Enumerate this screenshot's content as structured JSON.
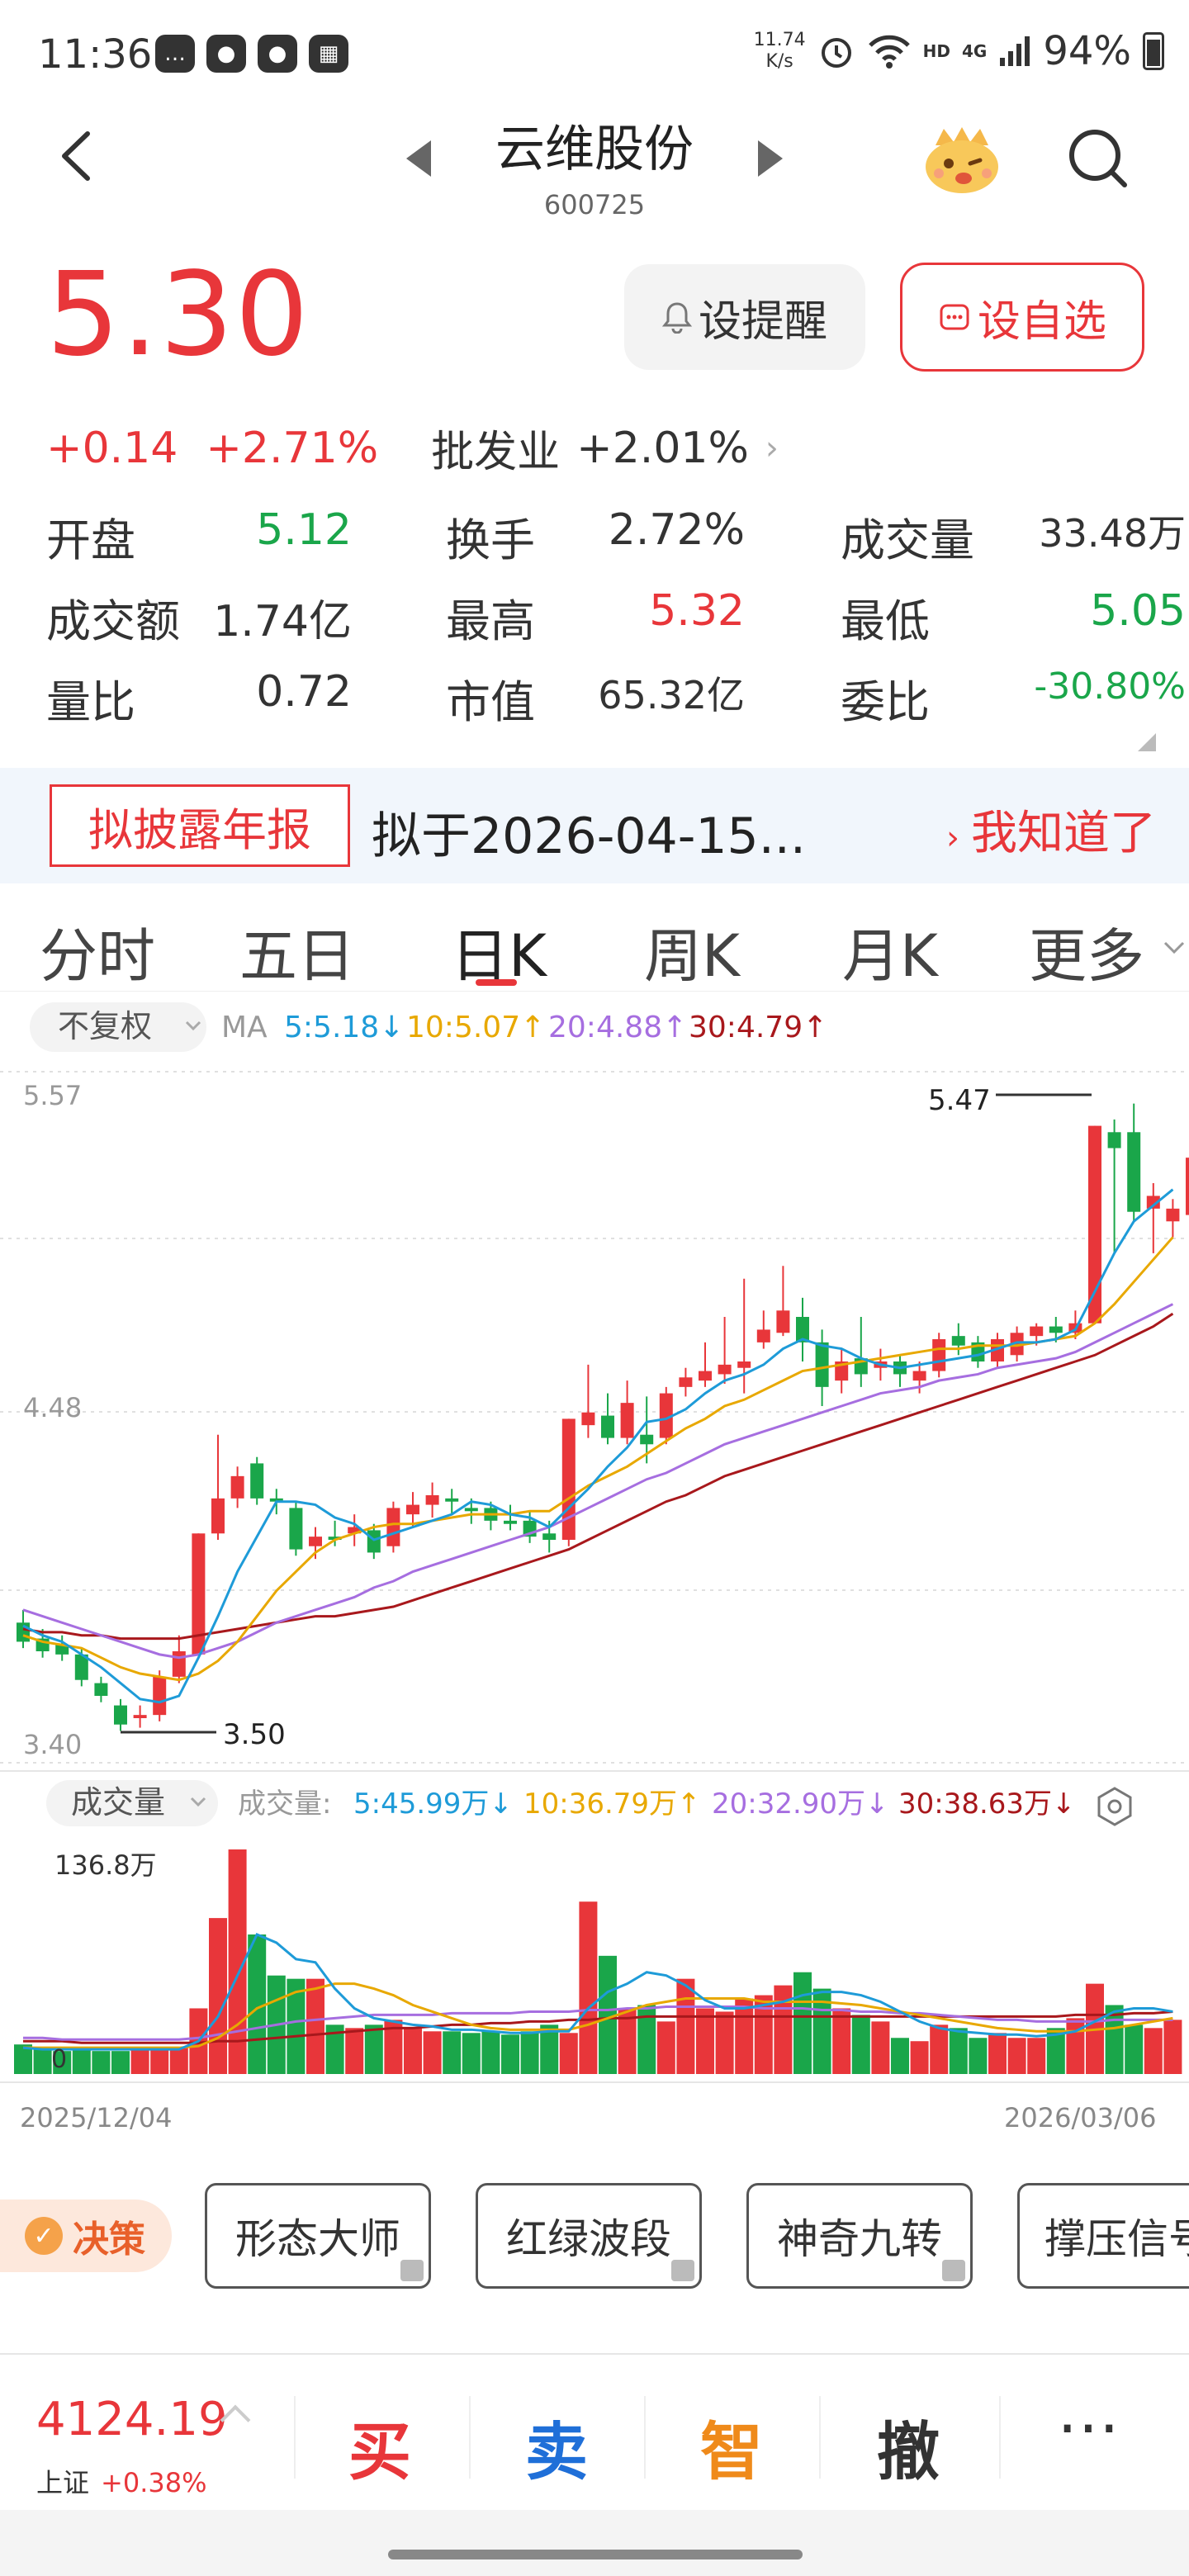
{
  "status": {
    "time": "11:36",
    "net_speed_value": "11.74",
    "net_speed_unit": "K/s",
    "network": "4G",
    "hd": "HD",
    "battery": "94%"
  },
  "header": {
    "title": "云维股份",
    "code": "600725"
  },
  "quote": {
    "price": "5.30",
    "change": "+0.14",
    "change_pct": "+2.71%",
    "industry": "批发业",
    "industry_pct": "+2.01%",
    "remind_label": "设提醒",
    "favorite_label": "设自选"
  },
  "stats": {
    "open_label": "开盘",
    "open": "5.12",
    "turnover_label": "换手",
    "turnover": "2.72%",
    "volume_label": "成交量",
    "volume": "33.48万",
    "amount_label": "成交额",
    "amount": "1.74亿",
    "high_label": "最高",
    "high": "5.32",
    "low_label": "最低",
    "low": "5.05",
    "vol_ratio_label": "量比",
    "vol_ratio": "0.72",
    "mcap_label": "市值",
    "mcap": "65.32亿",
    "bid_ratio_label": "委比",
    "bid_ratio": "-30.80%"
  },
  "banner": {
    "tag": "拟披露年报",
    "text": "拟于2026-04-15...",
    "dismiss": "我知道了"
  },
  "tabs": [
    "分时",
    "五日",
    "日K",
    "周K",
    "月K",
    "更多"
  ],
  "active_tab": "日K",
  "colors": {
    "up": "#e8363a",
    "down": "#1aa64a",
    "ma5": "#1e9bd8",
    "ma10": "#e8a800",
    "ma20": "#a66ee0",
    "ma30": "#a8181c"
  },
  "kline": {
    "adjust_label": "不复权",
    "ma_label": "MA",
    "ma5": "5:5.18↓",
    "ma10": "10:5.07↑",
    "ma20": "20:4.88↑",
    "ma30": "30:4.79↑",
    "y_top": "5.57",
    "y_mid": "4.48",
    "y_bottom": "3.40",
    "max_label": "5.47",
    "min_label": "3.50"
  },
  "volume": {
    "selector_label": "成交量",
    "prefix": "成交量:",
    "ma5": "5:45.99万↓",
    "ma10": "10:36.79万↑",
    "ma20": "20:32.90万↓",
    "ma30": "30:38.63万↓",
    "max_label": "136.8万",
    "zero_label": "0",
    "date_start": "2025/12/04",
    "date_end": "2026/03/06"
  },
  "chart_data": {
    "type": "candlestick",
    "ylim": [
      3.4,
      5.57
    ],
    "candles": [
      {
        "o": 3.84,
        "c": 3.78,
        "h": 3.88,
        "l": 3.76
      },
      {
        "o": 3.79,
        "c": 3.75,
        "h": 3.82,
        "l": 3.73
      },
      {
        "o": 3.77,
        "c": 3.74,
        "h": 3.8,
        "l": 3.72
      },
      {
        "o": 3.74,
        "c": 3.66,
        "h": 3.76,
        "l": 3.64
      },
      {
        "o": 3.65,
        "c": 3.61,
        "h": 3.67,
        "l": 3.59
      },
      {
        "o": 3.58,
        "c": 3.52,
        "h": 3.6,
        "l": 3.5
      },
      {
        "o": 3.54,
        "c": 3.55,
        "h": 3.58,
        "l": 3.51
      },
      {
        "o": 3.55,
        "c": 3.67,
        "h": 3.69,
        "l": 3.53
      },
      {
        "o": 3.67,
        "c": 3.75,
        "h": 3.8,
        "l": 3.65
      },
      {
        "o": 3.74,
        "c": 4.12,
        "h": 4.12,
        "l": 3.74
      },
      {
        "o": 4.12,
        "c": 4.23,
        "h": 4.43,
        "l": 4.1
      },
      {
        "o": 4.23,
        "c": 4.3,
        "h": 4.33,
        "l": 4.2
      },
      {
        "o": 4.34,
        "c": 4.23,
        "h": 4.36,
        "l": 4.21
      },
      {
        "o": 4.23,
        "c": 4.22,
        "h": 4.26,
        "l": 4.18
      },
      {
        "o": 4.2,
        "c": 4.07,
        "h": 4.22,
        "l": 4.05
      },
      {
        "o": 4.08,
        "c": 4.11,
        "h": 4.14,
        "l": 4.04
      },
      {
        "o": 4.11,
        "c": 4.1,
        "h": 4.16,
        "l": 4.08
      },
      {
        "o": 4.12,
        "c": 4.14,
        "h": 4.18,
        "l": 4.08
      },
      {
        "o": 4.13,
        "c": 4.06,
        "h": 4.15,
        "l": 4.04
      },
      {
        "o": 4.08,
        "c": 4.2,
        "h": 4.22,
        "l": 4.06
      },
      {
        "o": 4.18,
        "c": 4.21,
        "h": 4.25,
        "l": 4.14
      },
      {
        "o": 4.21,
        "c": 4.24,
        "h": 4.28,
        "l": 4.17
      },
      {
        "o": 4.23,
        "c": 4.22,
        "h": 4.26,
        "l": 4.18
      },
      {
        "o": 4.2,
        "c": 4.19,
        "h": 4.23,
        "l": 4.15
      },
      {
        "o": 4.2,
        "c": 4.16,
        "h": 4.22,
        "l": 4.13
      },
      {
        "o": 4.16,
        "c": 4.15,
        "h": 4.21,
        "l": 4.13
      },
      {
        "o": 4.16,
        "c": 4.11,
        "h": 4.19,
        "l": 4.09
      },
      {
        "o": 4.12,
        "c": 4.1,
        "h": 4.16,
        "l": 4.06
      },
      {
        "o": 4.1,
        "c": 4.48,
        "h": 4.48,
        "l": 4.08
      },
      {
        "o": 4.46,
        "c": 4.5,
        "h": 4.65,
        "l": 4.42
      },
      {
        "o": 4.49,
        "c": 4.42,
        "h": 4.56,
        "l": 4.4
      },
      {
        "o": 4.42,
        "c": 4.53,
        "h": 4.6,
        "l": 4.4
      },
      {
        "o": 4.43,
        "c": 4.4,
        "h": 4.55,
        "l": 4.34
      },
      {
        "o": 4.42,
        "c": 4.56,
        "h": 4.58,
        "l": 4.4
      },
      {
        "o": 4.58,
        "c": 4.61,
        "h": 4.64,
        "l": 4.55
      },
      {
        "o": 4.6,
        "c": 4.63,
        "h": 4.72,
        "l": 4.58
      },
      {
        "o": 4.62,
        "c": 4.65,
        "h": 4.8,
        "l": 4.59
      },
      {
        "o": 4.64,
        "c": 4.66,
        "h": 4.92,
        "l": 4.56
      },
      {
        "o": 4.72,
        "c": 4.76,
        "h": 4.82,
        "l": 4.7
      },
      {
        "o": 4.75,
        "c": 4.82,
        "h": 4.96,
        "l": 4.74
      },
      {
        "o": 4.8,
        "c": 4.72,
        "h": 4.86,
        "l": 4.66
      },
      {
        "o": 4.72,
        "c": 4.58,
        "h": 4.76,
        "l": 4.52
      },
      {
        "o": 4.6,
        "c": 4.66,
        "h": 4.7,
        "l": 4.56
      },
      {
        "o": 4.67,
        "c": 4.62,
        "h": 4.8,
        "l": 4.58
      },
      {
        "o": 4.64,
        "c": 4.66,
        "h": 4.7,
        "l": 4.6
      },
      {
        "o": 4.66,
        "c": 4.62,
        "h": 4.68,
        "l": 4.58
      },
      {
        "o": 4.6,
        "c": 4.63,
        "h": 4.66,
        "l": 4.56
      },
      {
        "o": 4.63,
        "c": 4.73,
        "h": 4.75,
        "l": 4.61
      },
      {
        "o": 4.74,
        "c": 4.71,
        "h": 4.78,
        "l": 4.68
      },
      {
        "o": 4.72,
        "c": 4.66,
        "h": 4.74,
        "l": 4.64
      },
      {
        "o": 4.66,
        "c": 4.73,
        "h": 4.75,
        "l": 4.64
      },
      {
        "o": 4.68,
        "c": 4.75,
        "h": 4.77,
        "l": 4.66
      },
      {
        "o": 4.74,
        "c": 4.77,
        "h": 4.78,
        "l": 4.71
      },
      {
        "o": 4.77,
        "c": 4.75,
        "h": 4.8,
        "l": 4.72
      },
      {
        "o": 4.75,
        "c": 4.78,
        "h": 4.82,
        "l": 4.73
      },
      {
        "o": 4.78,
        "c": 5.4,
        "h": 5.4,
        "l": 4.78
      },
      {
        "o": 5.38,
        "c": 5.33,
        "h": 5.42,
        "l": 5.0
      },
      {
        "o": 5.38,
        "c": 5.13,
        "h": 5.47,
        "l": 5.1
      },
      {
        "o": 5.14,
        "c": 5.18,
        "h": 5.22,
        "l": 5.0
      },
      {
        "o": 5.1,
        "c": 5.14,
        "h": 5.17,
        "l": 5.05
      },
      {
        "o": 5.12,
        "c": 5.3,
        "h": 5.32,
        "l": 5.05
      }
    ],
    "ma5": [
      3.83,
      3.8,
      3.78,
      3.74,
      3.7,
      3.65,
      3.6,
      3.59,
      3.61,
      3.73,
      3.86,
      4.0,
      4.11,
      4.22,
      4.22,
      4.21,
      4.17,
      4.15,
      4.1,
      4.12,
      4.14,
      4.16,
      4.18,
      4.22,
      4.21,
      4.18,
      4.17,
      4.14,
      4.2,
      4.26,
      4.33,
      4.39,
      4.47,
      4.48,
      4.51,
      4.56,
      4.6,
      4.62,
      4.65,
      4.7,
      4.73,
      4.71,
      4.7,
      4.67,
      4.65,
      4.64,
      4.65,
      4.66,
      4.67,
      4.68,
      4.7,
      4.72,
      4.72,
      4.73,
      4.76,
      4.88,
      5.0,
      5.1,
      5.15,
      5.2
    ],
    "ma10": [
      3.8,
      3.78,
      3.77,
      3.76,
      3.73,
      3.7,
      3.68,
      3.67,
      3.66,
      3.68,
      3.72,
      3.78,
      3.86,
      3.94,
      4.0,
      4.06,
      4.1,
      4.12,
      4.14,
      4.15,
      4.15,
      4.16,
      4.17,
      4.18,
      4.18,
      4.18,
      4.19,
      4.19,
      4.23,
      4.27,
      4.3,
      4.33,
      4.37,
      4.41,
      4.45,
      4.48,
      4.52,
      4.54,
      4.57,
      4.6,
      4.63,
      4.64,
      4.65,
      4.66,
      4.67,
      4.68,
      4.69,
      4.7,
      4.7,
      4.71,
      4.71,
      4.71,
      4.72,
      4.73,
      4.74,
      4.78,
      4.84,
      4.91,
      4.98,
      5.05
    ],
    "ma20": [
      3.88,
      3.86,
      3.84,
      3.82,
      3.8,
      3.78,
      3.76,
      3.74,
      3.73,
      3.74,
      3.76,
      3.78,
      3.81,
      3.84,
      3.86,
      3.88,
      3.9,
      3.92,
      3.95,
      3.97,
      4.0,
      4.02,
      4.04,
      4.06,
      4.08,
      4.1,
      4.12,
      4.14,
      4.17,
      4.2,
      4.23,
      4.26,
      4.29,
      4.31,
      4.34,
      4.37,
      4.4,
      4.42,
      4.44,
      4.46,
      4.48,
      4.5,
      4.52,
      4.54,
      4.56,
      4.57,
      4.58,
      4.6,
      4.61,
      4.62,
      4.64,
      4.65,
      4.66,
      4.67,
      4.69,
      4.72,
      4.75,
      4.78,
      4.81,
      4.84
    ],
    "ma30": [
      3.82,
      3.81,
      3.81,
      3.8,
      3.8,
      3.79,
      3.79,
      3.79,
      3.79,
      3.8,
      3.81,
      3.82,
      3.83,
      3.84,
      3.85,
      3.86,
      3.86,
      3.87,
      3.88,
      3.89,
      3.91,
      3.93,
      3.95,
      3.97,
      3.99,
      4.01,
      4.03,
      4.05,
      4.07,
      4.1,
      4.13,
      4.16,
      4.19,
      4.22,
      4.24,
      4.27,
      4.3,
      4.32,
      4.34,
      4.36,
      4.38,
      4.4,
      4.42,
      4.44,
      4.46,
      4.48,
      4.5,
      4.52,
      4.54,
      4.56,
      4.58,
      4.6,
      4.62,
      4.64,
      4.66,
      4.68,
      4.71,
      4.74,
      4.77,
      4.81
    ],
    "volume_ylim": [
      0,
      136.8
    ],
    "volume": [
      18,
      15,
      14,
      16,
      14,
      14,
      15,
      16,
      16,
      40,
      95,
      136.8,
      85,
      60,
      58,
      58,
      30,
      28,
      30,
      33,
      28,
      26,
      26,
      25,
      26,
      24,
      26,
      30,
      25,
      105,
      72,
      40,
      42,
      32,
      58,
      40,
      38,
      46,
      48,
      54,
      62,
      52,
      40,
      36,
      32,
      22,
      20,
      30,
      28,
      22,
      25,
      22,
      22,
      28,
      34,
      55,
      42,
      30,
      28,
      33
    ],
    "vol_ma5": [
      16,
      15,
      15,
      15,
      15,
      15,
      15,
      15,
      15,
      20,
      35,
      60,
      85,
      80,
      70,
      68,
      52,
      40,
      34,
      32,
      30,
      29,
      27,
      27,
      26,
      25,
      25,
      26,
      26,
      40,
      50,
      55,
      62,
      60,
      54,
      45,
      40,
      40,
      42,
      44,
      48,
      50,
      50,
      48,
      44,
      38,
      32,
      28,
      26,
      25,
      24,
      24,
      23,
      24,
      26,
      32,
      38,
      40,
      40,
      38
    ],
    "vol_ma10": [
      16,
      16,
      16,
      16,
      16,
      16,
      16,
      16,
      16,
      17,
      22,
      30,
      40,
      45,
      50,
      52,
      55,
      55,
      52,
      48,
      42,
      38,
      34,
      30,
      28,
      27,
      27,
      27,
      27,
      30,
      34,
      38,
      42,
      44,
      46,
      46,
      46,
      46,
      44,
      44,
      44,
      44,
      43,
      42,
      40,
      38,
      36,
      34,
      32,
      30,
      28,
      27,
      26,
      26,
      26,
      27,
      28,
      30,
      32,
      34
    ],
    "vol_ma20": [
      22,
      22,
      21,
      21,
      21,
      21,
      21,
      21,
      21,
      22,
      24,
      26,
      28,
      30,
      32,
      33,
      34,
      35,
      36,
      36,
      36,
      36,
      37,
      37,
      37,
      37,
      38,
      38,
      38,
      39,
      39,
      40,
      40,
      41,
      41,
      41,
      41,
      41,
      40,
      40,
      40,
      39,
      39,
      38,
      38,
      37,
      37,
      36,
      35,
      34,
      33,
      33,
      32,
      32,
      32,
      32,
      33,
      33,
      33,
      33
    ],
    "vol_ma30": [
      20,
      20,
      20,
      19,
      19,
      19,
      19,
      19,
      19,
      19,
      20,
      20,
      21,
      22,
      23,
      24,
      25,
      26,
      27,
      28,
      28,
      29,
      30,
      30,
      31,
      31,
      32,
      32,
      33,
      33,
      34,
      34,
      35,
      35,
      35,
      35,
      35,
      35,
      35,
      35,
      35,
      35,
      35,
      35,
      35,
      35,
      35,
      35,
      35,
      35,
      35,
      35,
      35,
      35,
      36,
      36,
      36,
      37,
      37,
      38
    ]
  },
  "strategies": {
    "decision_label": "决策",
    "items": [
      "形态大师",
      "红绿波段",
      "神奇九转",
      "撑压信号"
    ]
  },
  "bottom": {
    "index_value": "4124.19",
    "index_name": "上证",
    "index_pct": "+0.38%",
    "buy": "买",
    "sell": "卖",
    "smart": "智",
    "cancel": "撤",
    "more": "⋯"
  }
}
